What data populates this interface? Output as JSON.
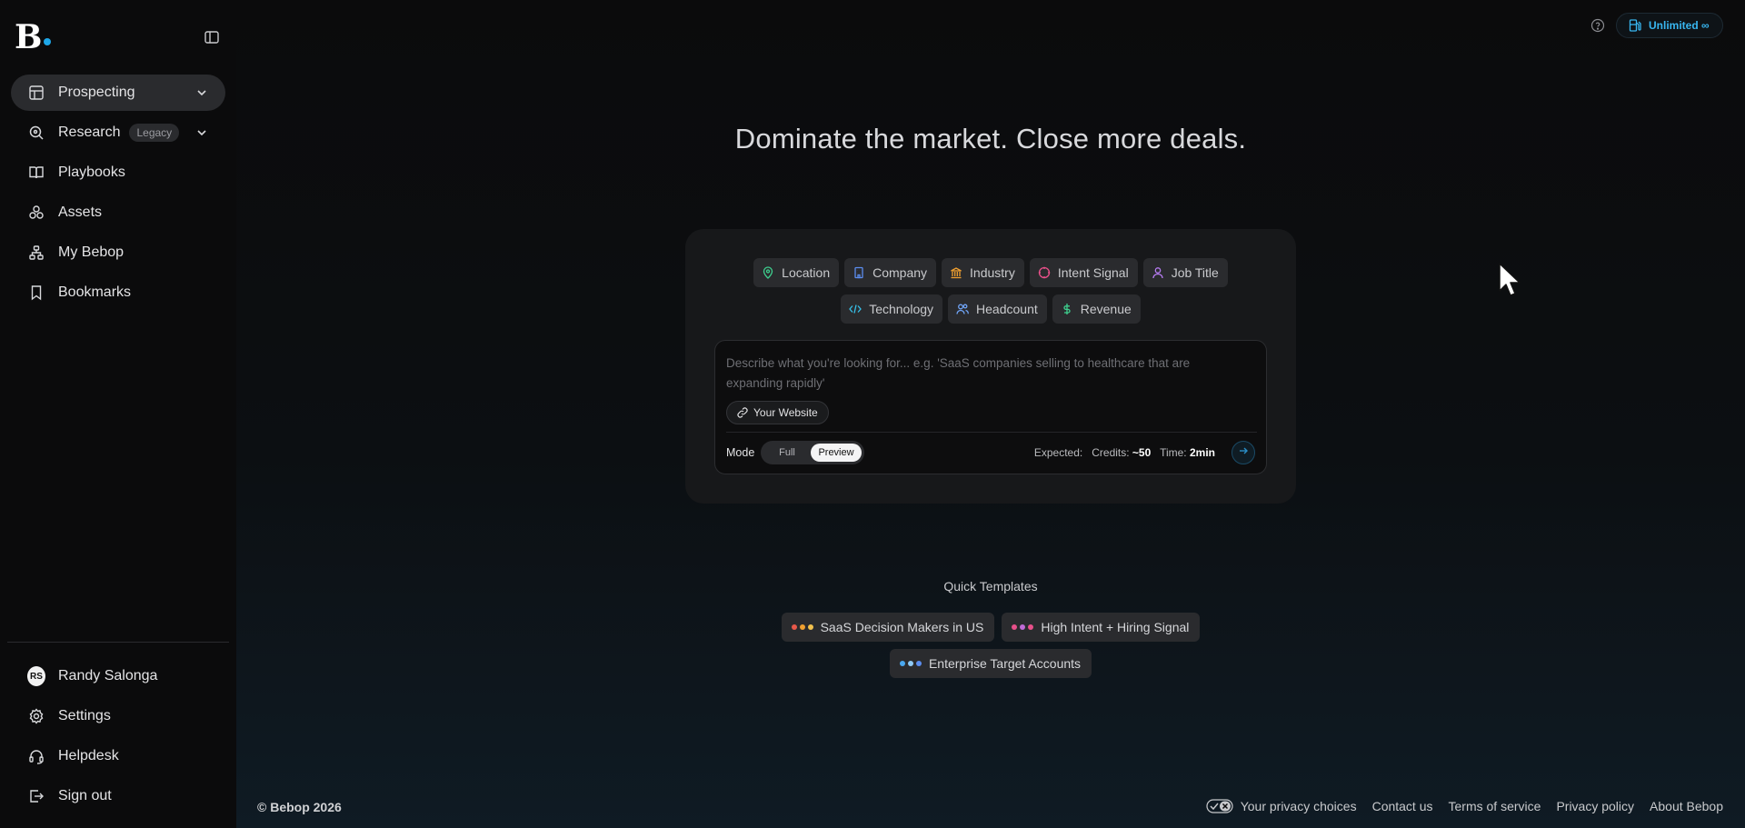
{
  "brand": {
    "logo_letter": "B",
    "accent": "#1ea7e8"
  },
  "sidebar": {
    "items": [
      {
        "label": "Prospecting",
        "icon": "table-icon"
      },
      {
        "label": "Research",
        "icon": "search-icon",
        "badge": "Legacy"
      },
      {
        "label": "Playbooks",
        "icon": "book-icon"
      },
      {
        "label": "Assets",
        "icon": "assets-icon"
      },
      {
        "label": "My Bebop",
        "icon": "network-icon"
      },
      {
        "label": "Bookmarks",
        "icon": "bookmark-icon"
      }
    ],
    "bottom": {
      "user": {
        "name": "Randy Salonga",
        "initials": "RS"
      },
      "settings": "Settings",
      "helpdesk": "Helpdesk",
      "sign_out": "Sign out"
    }
  },
  "topbar": {
    "plan_label": "Unlimited ∞"
  },
  "main": {
    "headline": "Dominate the market. Close more deals.",
    "filters": [
      {
        "label": "Location",
        "icon": "map-pin-icon",
        "color": "#3ecf8e"
      },
      {
        "label": "Company",
        "icon": "building-icon",
        "color": "#5b8def"
      },
      {
        "label": "Industry",
        "icon": "bank-icon",
        "color": "#f0a030"
      },
      {
        "label": "Intent Signal",
        "icon": "target-icon",
        "color": "#e8508a"
      },
      {
        "label": "Job Title",
        "icon": "user-icon",
        "color": "#b57bf0"
      },
      {
        "label": "Technology",
        "icon": "code-icon",
        "color": "#36c0e8"
      },
      {
        "label": "Headcount",
        "icon": "users-icon",
        "color": "#6fa3f5"
      },
      {
        "label": "Revenue",
        "icon": "dollar-icon",
        "color": "#3ecf8e"
      }
    ],
    "prompt_placeholder": "Describe what you're looking for... e.g. 'SaaS companies selling to healthcare that are expanding rapidly'",
    "website_button": "Your Website",
    "mode": {
      "label": "Mode",
      "options": [
        "Full",
        "Preview"
      ],
      "selected": "Preview"
    },
    "expected": {
      "label": "Expected:",
      "credits_label": "Credits:",
      "credits_value": "~50",
      "time_label": "Time:",
      "time_value": "2min"
    }
  },
  "templates": {
    "title": "Quick Templates",
    "items": [
      {
        "label": "SaaS Decision Makers in US",
        "dots": [
          "#e8584a",
          "#f0a030",
          "#f2c14e"
        ]
      },
      {
        "label": "High Intent + Hiring Signal",
        "dots": [
          "#e8508a",
          "#c06bd6",
          "#e8508a"
        ]
      },
      {
        "label": "Enterprise Target Accounts",
        "dots": [
          "#4aa8f0",
          "#8ec9f5",
          "#5b8def"
        ]
      }
    ]
  },
  "footer": {
    "copyright": "© Bebop 2026",
    "links": [
      "Your privacy choices",
      "Contact us",
      "Terms of service",
      "Privacy policy",
      "About Bebop"
    ]
  }
}
